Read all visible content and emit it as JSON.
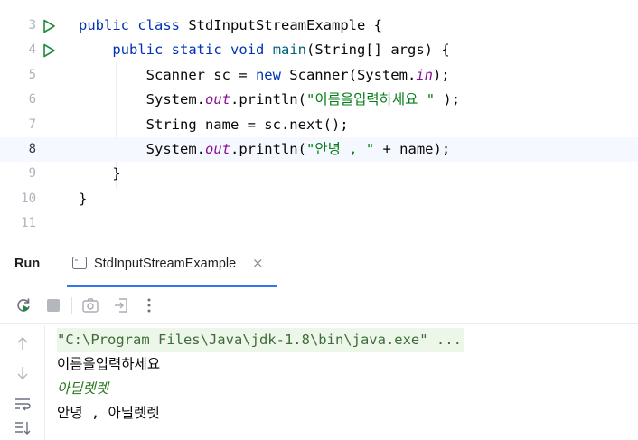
{
  "editor": {
    "current_line": "8",
    "lines": [
      {
        "num": "3",
        "run": true,
        "tokens": [
          [
            "kw",
            "public"
          ],
          [
            "",
            " "
          ],
          [
            "kw",
            "class"
          ],
          [
            "",
            " StdInputStreamExample {"
          ]
        ]
      },
      {
        "num": "4",
        "run": true,
        "tokens": [
          [
            "",
            "    "
          ],
          [
            "kw",
            "public"
          ],
          [
            "",
            " "
          ],
          [
            "kw",
            "static"
          ],
          [
            "",
            " "
          ],
          [
            "kw",
            "void"
          ],
          [
            "",
            " "
          ],
          [
            "fn",
            "main"
          ],
          [
            "",
            "(String[] args) {"
          ]
        ]
      },
      {
        "num": "5",
        "run": false,
        "tokens": [
          [
            "",
            "        Scanner sc = "
          ],
          [
            "kw",
            "new"
          ],
          [
            "",
            " Scanner(System."
          ],
          [
            "fld",
            "in"
          ],
          [
            "",
            ");"
          ]
        ]
      },
      {
        "num": "6",
        "run": false,
        "tokens": [
          [
            "",
            "        System."
          ],
          [
            "fld",
            "out"
          ],
          [
            "",
            ".println("
          ],
          [
            "str",
            "\"이름을입력하세요 \""
          ],
          [
            "",
            " );"
          ]
        ]
      },
      {
        "num": "7",
        "run": false,
        "tokens": [
          [
            "",
            "        String name = sc.next();"
          ]
        ]
      },
      {
        "num": "8",
        "run": false,
        "tokens": [
          [
            "",
            "        System."
          ],
          [
            "fld",
            "out"
          ],
          [
            "",
            ".println("
          ],
          [
            "str",
            "\"안녕 , \""
          ],
          [
            "",
            " + name);"
          ]
        ]
      },
      {
        "num": "9",
        "run": false,
        "tokens": [
          [
            "",
            "    }"
          ]
        ]
      },
      {
        "num": "10",
        "run": false,
        "tokens": [
          [
            "",
            "}"
          ]
        ]
      },
      {
        "num": "11",
        "run": false,
        "tokens": []
      }
    ]
  },
  "run_panel": {
    "title": "Run",
    "tab_label": "StdInputStreamExample",
    "tab_close": "×"
  },
  "toolbar": {
    "icons": [
      "rerun-icon",
      "stop-icon",
      "screenshot-icon",
      "exit-icon",
      "more-vertical-icon"
    ]
  },
  "console": {
    "lines": [
      {
        "type": "cmd",
        "text": "\"C:\\Program Files\\Java\\jdk-1.8\\bin\\java.exe\" ..."
      },
      {
        "type": "out",
        "text": "이름을입력하세요"
      },
      {
        "type": "input",
        "text": "아딜렛렛"
      },
      {
        "type": "out",
        "text": "안녕 , 아딜렛렛"
      }
    ]
  },
  "colors": {
    "accent": "#3574f0",
    "run_green": "#208a3c",
    "keyword": "#0033b3",
    "string": "#067d17",
    "field": "#871094"
  }
}
